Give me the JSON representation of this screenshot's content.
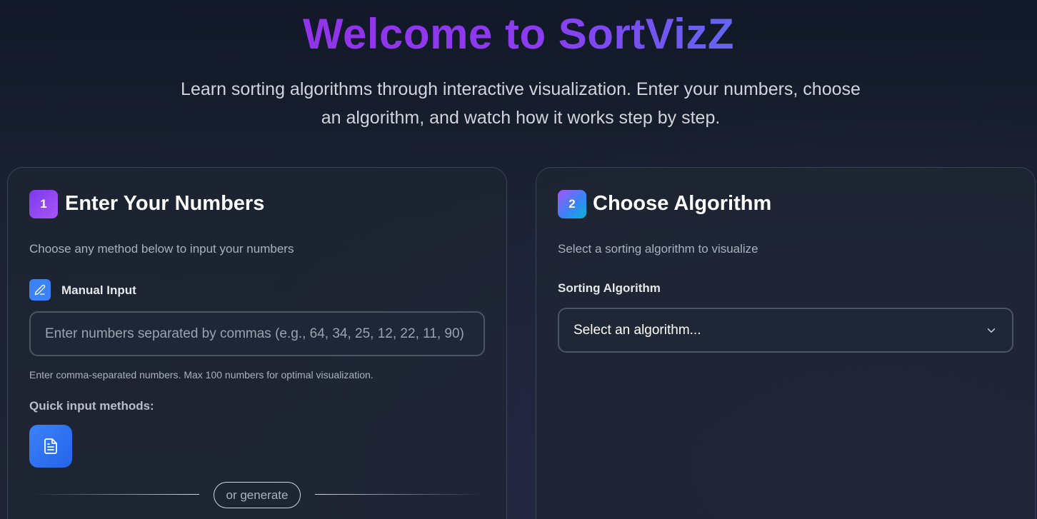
{
  "hero": {
    "title": "Welcome to SortVizZ",
    "subtitle": "Learn sorting algorithms through interactive visualization. Enter your numbers, choose an algorithm, and watch how it works step by step."
  },
  "step1": {
    "number": "1",
    "title": "Enter Your Numbers",
    "description": "Choose any method below to input your numbers",
    "manual_label": "Manual Input",
    "input_placeholder": "Enter numbers separated by commas (e.g., 64, 34, 25, 12, 22, 11, 90)",
    "input_value": "",
    "hint": "Enter comma-separated numbers. Max 100 numbers for optimal visualization.",
    "quick_label": "Quick input methods:",
    "or_generate": "or generate"
  },
  "step2": {
    "number": "2",
    "title": "Choose Algorithm",
    "description": "Select a sorting algorithm to visualize",
    "select_label": "Sorting Algorithm",
    "select_value": "Select an algorithm..."
  },
  "icons": {
    "manual_input": "pencil-icon",
    "quick_input": "file-text-icon",
    "select_arrow": "chevron-down-icon"
  },
  "colors": {
    "title_gradient_start": "#9333ea",
    "title_gradient_end": "#6366f1",
    "accent_blue": "#3b82f6",
    "badge_purple": "#7c3aed"
  }
}
